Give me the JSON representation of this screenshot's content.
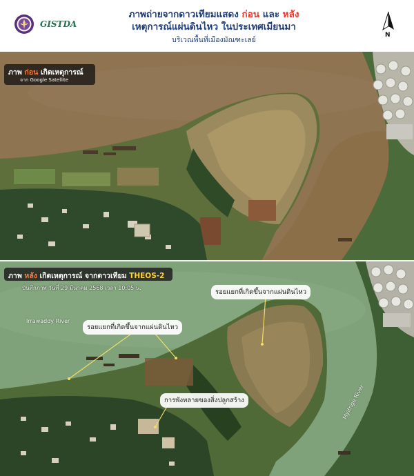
{
  "header": {
    "title_line1_pre": "ภาพถ่ายจากดาวเทียมแสดง ",
    "title_before_word": "ก่อน",
    "title_mid": " และ ",
    "title_after_word": "หลัง",
    "title_line2": "เหตุการณ์แผ่นดินไหว ในประเทศเมียนมา",
    "subtitle": "บริเวณพื้นที่เมืองมัณฑะเลย์",
    "logo_text": "GISTDA",
    "north_label": "N"
  },
  "before_panel": {
    "caption_prefix": "ภาพ ",
    "caption_highlight": "ก่อน",
    "caption_suffix": " เกิดเหตุการณ์",
    "source": "จาก Google Satellite"
  },
  "after_panel": {
    "caption_prefix": "ภาพ ",
    "caption_highlight": "หลัง",
    "caption_mid": " เกิดเหตุการณ์ จากดาวเทียม ",
    "caption_satellite": "THEOS-2",
    "date_text": "บันทึกภาพ วันที่ 29 มีนาคม 2568 เวลา 10:05 น.",
    "label_crack_right": "รอยแยกที่เกิดขึ้นจากแผ่นดินไหว",
    "label_crack_left": "รอยแยกที่เกิดขึ้นจากแผ่นดินไหว",
    "label_collapse": "การพังทลายของสิ่งปลูกสร้าง",
    "river_irrawaddy": "Irrawaddy River",
    "river_myitnge": "Myitnge River"
  },
  "colors": {
    "title_blue": "#1f3b73",
    "highlight_red": "#e23b2e",
    "before_water": "#8a6f48",
    "after_water": "#7fa27a",
    "annotation_line": "#f3dc6a"
  }
}
